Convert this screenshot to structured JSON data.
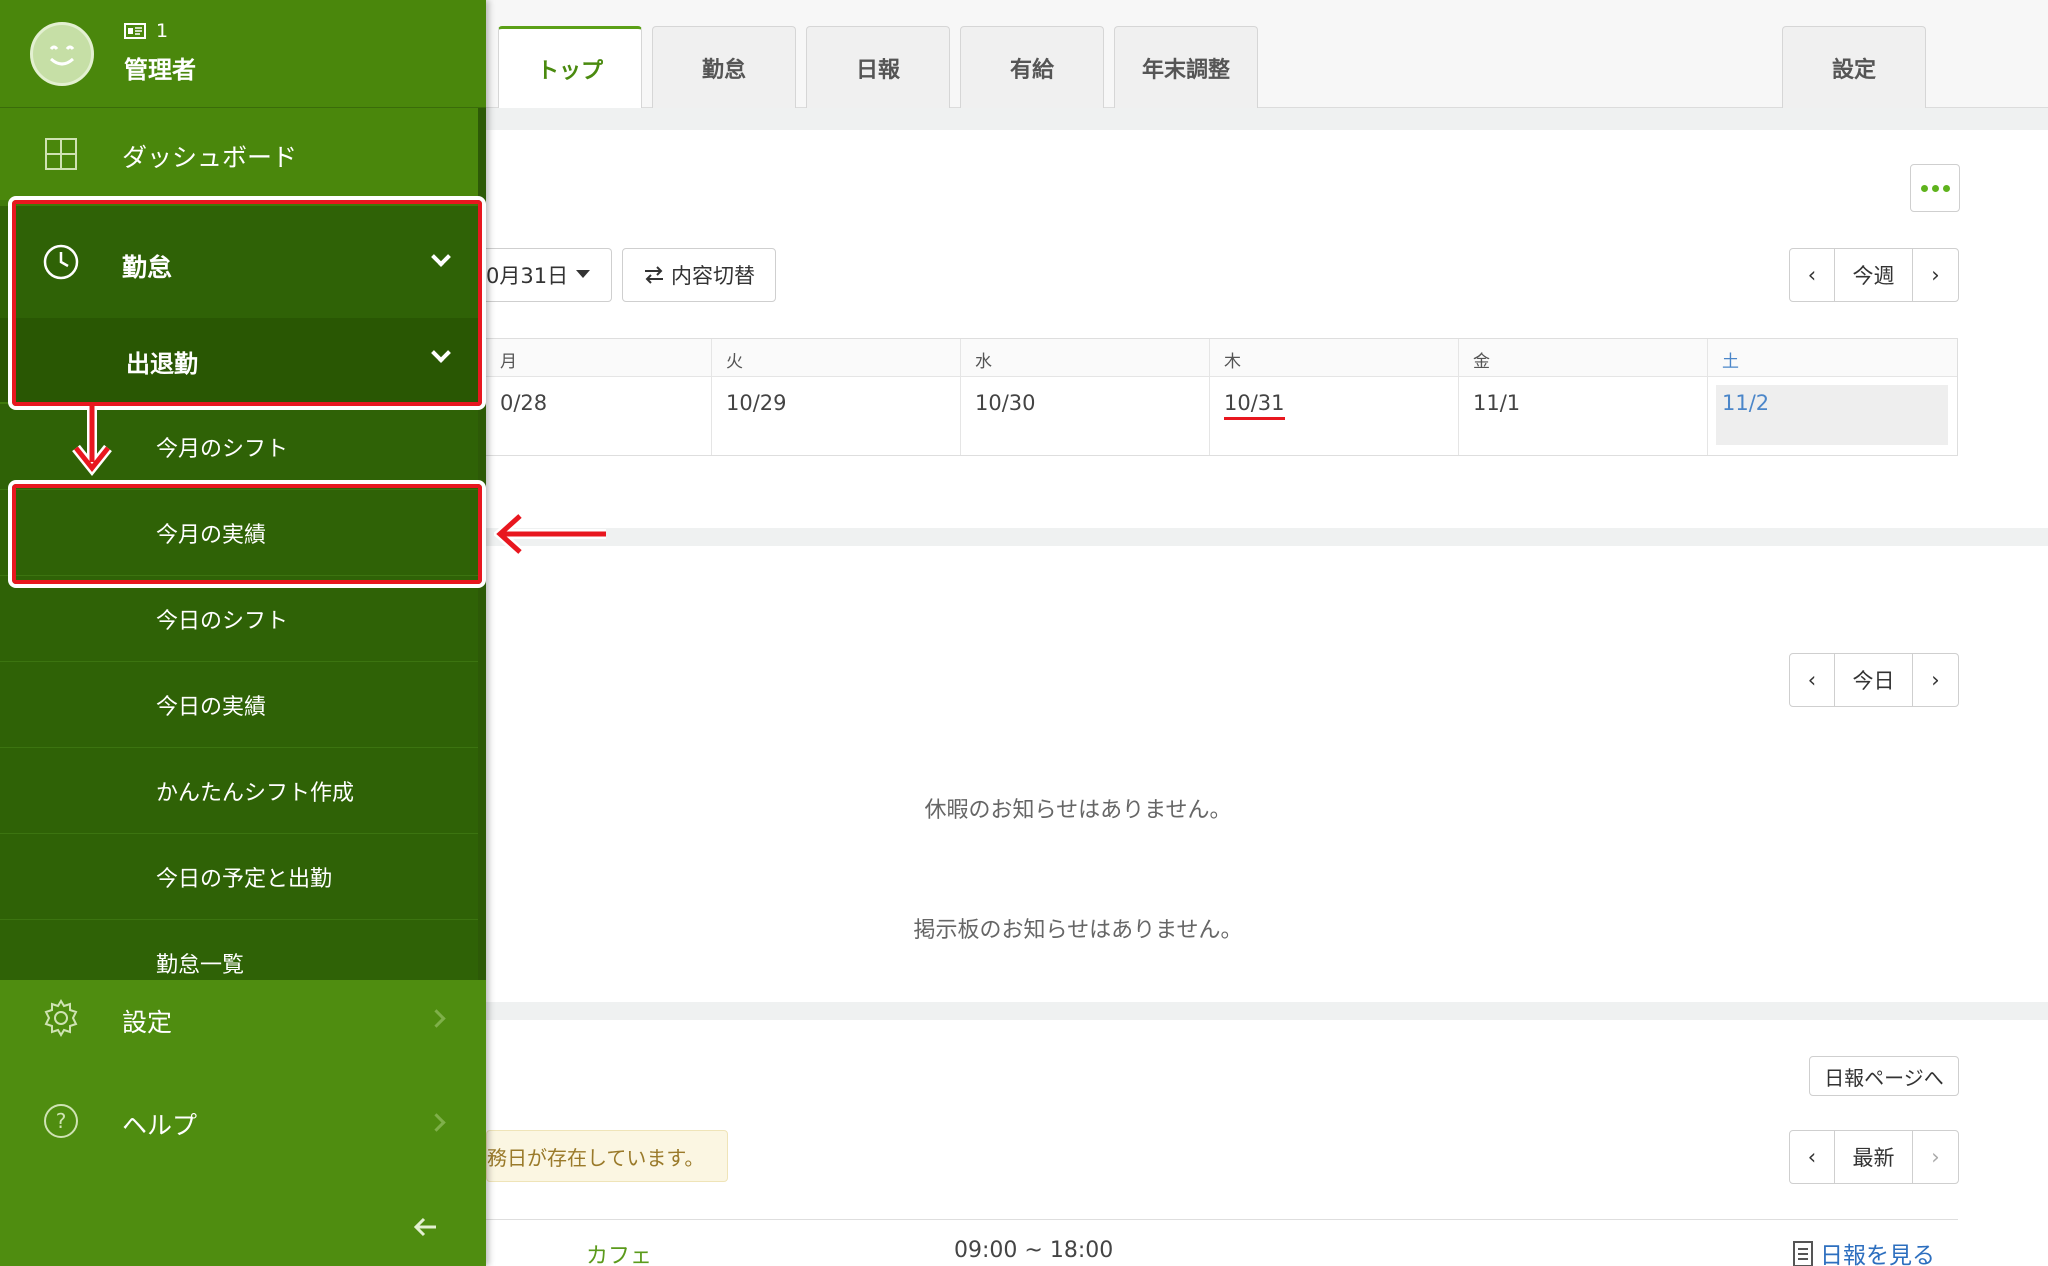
{
  "header": {
    "tabs": [
      {
        "label": "トップ",
        "active": true
      },
      {
        "label": "勤怠",
        "active": false
      },
      {
        "label": "日報",
        "active": false
      },
      {
        "label": "有給",
        "active": false
      },
      {
        "label": "年末調整",
        "active": false
      }
    ],
    "settings_tab": "設定"
  },
  "user": {
    "id": "1",
    "name": "管理者",
    "icon": "id-card-icon"
  },
  "sidebar": {
    "dashboard": "ダッシュボード",
    "attendance": "勤怠",
    "clock_in_out": "出退勤",
    "submenu": [
      "今月のシフト",
      "今月の実績",
      "今日のシフト",
      "今日の実績",
      "かんたんシフト作成",
      "今日の予定と出勤",
      "勤怠一覧"
    ],
    "settings": "設定",
    "help": "ヘルプ",
    "collapse_icon": "arrow-left-icon"
  },
  "week_section": {
    "date_select": "0月31日",
    "toggle_button": "内容切替",
    "nav_center": "今週",
    "weekday_headers": [
      "月",
      "火",
      "水",
      "木",
      "金",
      "土"
    ],
    "dates": [
      "0/28",
      "10/29",
      "10/30",
      "10/31",
      "11/1",
      "11/2"
    ],
    "today_index": 3,
    "colors": {
      "accent": "#5ba017",
      "saturday": "#4b86c9",
      "today_underline": "#e8171f"
    }
  },
  "notice_section": {
    "nav_center": "今日",
    "vacation_notice": "休暇のお知らせはありません。",
    "board_notice": "掲示板のお知らせはありません。"
  },
  "report_section": {
    "page_link": "日報ページへ",
    "nav_center": "最新",
    "warning": "務日が存在しています。",
    "row": {
      "store": "カフェ",
      "time": "09:00 ~ 18:00",
      "view_link": "日報を見る"
    }
  }
}
